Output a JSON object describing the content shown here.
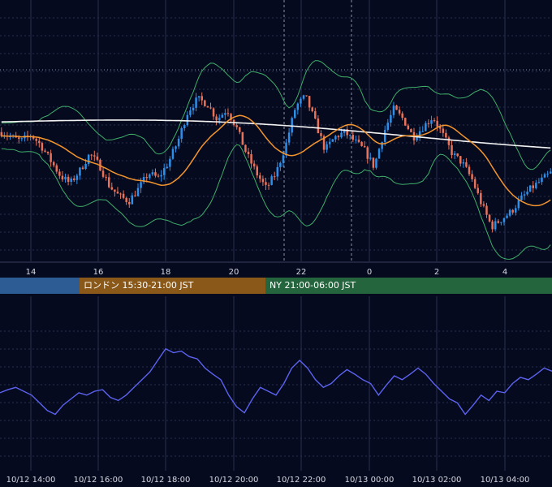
{
  "colors": {
    "background": "#060a1e",
    "bull": "#2f8fe8",
    "bear": "#e8735a",
    "ma_long": "#f2f2f2",
    "ma_mid": "#f2952f",
    "bollinger": "#3fae6a",
    "oscillator": "#5b63f0",
    "grid_minor": "#2a3050",
    "grid_major": "#8890a8"
  },
  "sessions": [
    {
      "label": "",
      "color": "#2c5c93"
    },
    {
      "label": "ロンドン 15:30-21:00 JST",
      "color": "#8a5818"
    },
    {
      "label": "NY 21:00-06:00 JST",
      "color": "#25653d"
    }
  ],
  "chart_data": [
    {
      "type": "candlestick",
      "title": "",
      "x_tick_labels": [
        "14",
        "16",
        "18",
        "20",
        "22",
        "0",
        "2",
        "4"
      ],
      "overlays": [
        "moving-average-long",
        "moving-average-mid",
        "bollinger-upper",
        "bollinger-lower"
      ],
      "price_path": [
        0.62,
        0.58,
        0.55,
        0.6,
        0.52,
        0.4,
        0.28,
        0.22,
        0.32,
        0.45,
        0.36,
        0.2,
        0.12,
        0.08,
        0.18,
        0.3,
        0.26,
        0.38,
        0.55,
        0.78,
        0.88,
        0.84,
        0.72,
        0.8,
        0.65,
        0.45,
        0.3,
        0.18,
        0.3,
        0.52,
        0.82,
        0.9,
        0.7,
        0.48,
        0.58,
        0.62,
        0.55,
        0.48,
        0.35,
        0.62,
        0.8,
        0.72,
        0.58,
        0.66,
        0.74,
        0.6,
        0.45,
        0.38,
        0.25,
        0.05,
        -0.12,
        -0.06,
        0.0,
        0.1,
        0.18,
        0.24,
        0.3
      ],
      "ylim": [
        -0.25,
        1.05
      ]
    },
    {
      "type": "line",
      "title": "",
      "x_tick_labels": [
        "10/12 14:00",
        "10/12 16:00",
        "10/12 18:00",
        "10/12 20:00",
        "10/12 22:00",
        "10/13 00:00",
        "10/13 02:00",
        "10/13 04:00"
      ],
      "values": [
        0.38,
        0.42,
        0.45,
        0.4,
        0.35,
        0.25,
        0.15,
        0.1,
        0.22,
        0.3,
        0.38,
        0.35,
        0.4,
        0.42,
        0.32,
        0.28,
        0.35,
        0.45,
        0.55,
        0.65,
        0.8,
        0.95,
        0.9,
        0.92,
        0.85,
        0.82,
        0.7,
        0.62,
        0.55,
        0.35,
        0.2,
        0.12,
        0.3,
        0.45,
        0.4,
        0.35,
        0.5,
        0.7,
        0.8,
        0.7,
        0.55,
        0.45,
        0.5,
        0.6,
        0.68,
        0.62,
        0.55,
        0.5,
        0.35,
        0.48,
        0.6,
        0.55,
        0.62,
        0.7,
        0.62,
        0.5,
        0.4,
        0.3,
        0.25,
        0.1,
        0.22,
        0.35,
        0.28,
        0.4,
        0.38,
        0.5,
        0.58,
        0.55,
        0.62,
        0.7,
        0.66
      ],
      "ylim": [
        0,
        1
      ]
    }
  ]
}
